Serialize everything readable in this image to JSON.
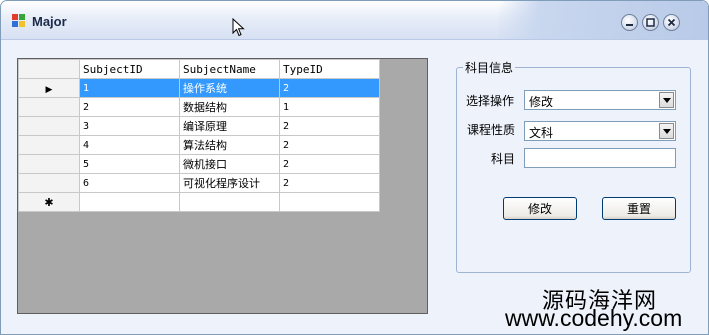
{
  "window": {
    "title": "Major"
  },
  "grid": {
    "columns": [
      "SubjectID",
      "SubjectName",
      "TypeID"
    ],
    "rows": [
      [
        "1",
        "操作系统",
        "2"
      ],
      [
        "2",
        "数据结构",
        "1"
      ],
      [
        "3",
        "编译原理",
        "2"
      ],
      [
        "4",
        "算法结构",
        "2"
      ],
      [
        "5",
        "微机接口",
        "2"
      ],
      [
        "6",
        "可视化程序设计",
        "2"
      ]
    ],
    "selected_row": 0,
    "new_row_marker": "✱",
    "current_row_marker": "▶"
  },
  "panel": {
    "title": "科目信息",
    "op_label": "选择操作",
    "op_value": "修改",
    "type_label": "课程性质",
    "type_value": "文科",
    "subject_label": "科目",
    "subject_value": "",
    "modify_button": "修改",
    "reset_button": "重置"
  },
  "watermark": {
    "line1": "源码海洋网",
    "line2": "www.codehy.com"
  },
  "colors": {
    "selection": "#3399ff",
    "grid_background": "#a9a9a9",
    "window_bg": "#eef2fb"
  }
}
